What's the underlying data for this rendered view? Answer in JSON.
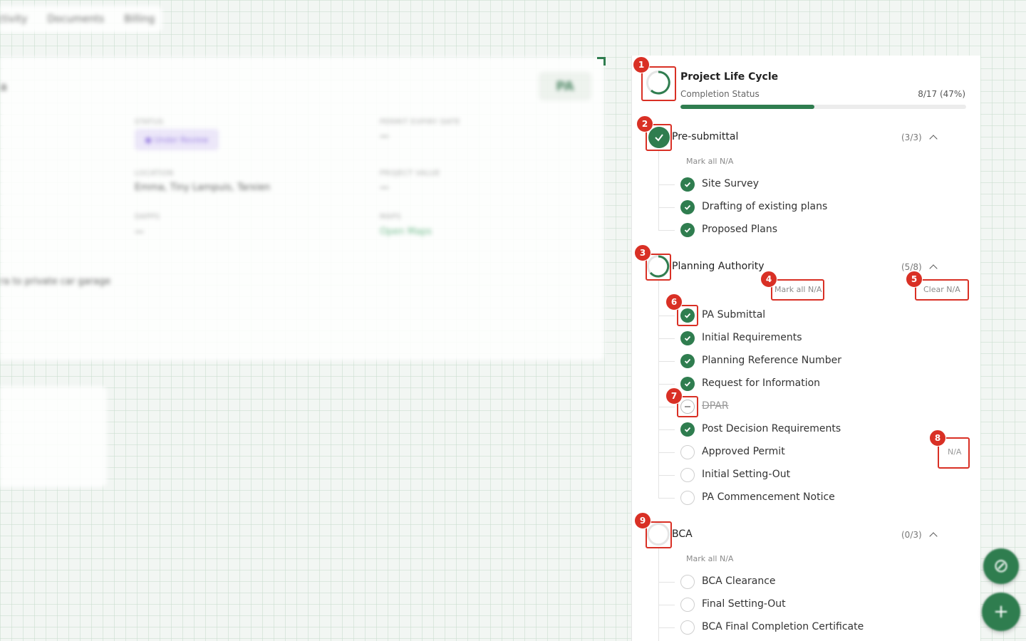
{
  "background": {
    "tabs": [
      "Activity",
      "Documents",
      "Billing"
    ],
    "heading": "a",
    "pa_badge": "PA",
    "fields": [
      {
        "label": "STATUS",
        "value": ""
      },
      {
        "label": "PERMIT EXPIRY DATE",
        "value": "—"
      },
      {
        "label": "LOCATION",
        "value": "Emma, Tiny Lampuis, Tarxien"
      },
      {
        "label": "PROJECT VALUE",
        "value": "—"
      },
      {
        "label": "DAPPS",
        "value": "—"
      },
      {
        "label": "MAPS",
        "value": "Open Maps"
      }
    ],
    "status_pill": "● Under Review",
    "description": "ra to private car garage"
  },
  "panel": {
    "title": "Project Life Cycle",
    "subtitle": "Completion Status",
    "count": "8/17 (47%)",
    "progress_fraction": 0.47,
    "sections": [
      {
        "title": "Pre-submittal",
        "count": "(3/3)",
        "mark_all": "Mark all N/A",
        "items": [
          {
            "label": "Site Survey",
            "state": "done"
          },
          {
            "label": "Drafting of existing plans",
            "state": "done"
          },
          {
            "label": "Proposed Plans",
            "state": "done"
          }
        ]
      },
      {
        "title": "Planning Authority",
        "count": "(5/8)",
        "mark_all": "Mark all N/A",
        "clear_na": "Clear N/A",
        "item_na_label": "N/A",
        "items": [
          {
            "label": "PA Submittal",
            "state": "done"
          },
          {
            "label": "Initial Requirements",
            "state": "done"
          },
          {
            "label": "Planning Reference Number",
            "state": "done"
          },
          {
            "label": "Request for Information",
            "state": "done"
          },
          {
            "label": "DPAR",
            "state": "na"
          },
          {
            "label": "Post Decision Requirements",
            "state": "done"
          },
          {
            "label": "Approved Permit",
            "state": "pending"
          },
          {
            "label": "Initial Setting-Out",
            "state": "pending"
          },
          {
            "label": "PA Commencement Notice",
            "state": "pending"
          }
        ]
      },
      {
        "title": "BCA",
        "count": "(0/3)",
        "mark_all": "Mark all N/A",
        "items": [
          {
            "label": "BCA Clearance",
            "state": "pending"
          },
          {
            "label": "Final Setting-Out",
            "state": "pending"
          },
          {
            "label": "BCA Final Completion Certificate",
            "state": "pending"
          }
        ]
      }
    ]
  },
  "annotations": [
    "1",
    "2",
    "3",
    "4",
    "5",
    "6",
    "7",
    "8",
    "9"
  ],
  "colors": {
    "accent": "#2f7d4f",
    "annotation": "#d93025"
  },
  "icons": {
    "fab_top": "link-icon",
    "fab_bottom": "plus-icon"
  }
}
